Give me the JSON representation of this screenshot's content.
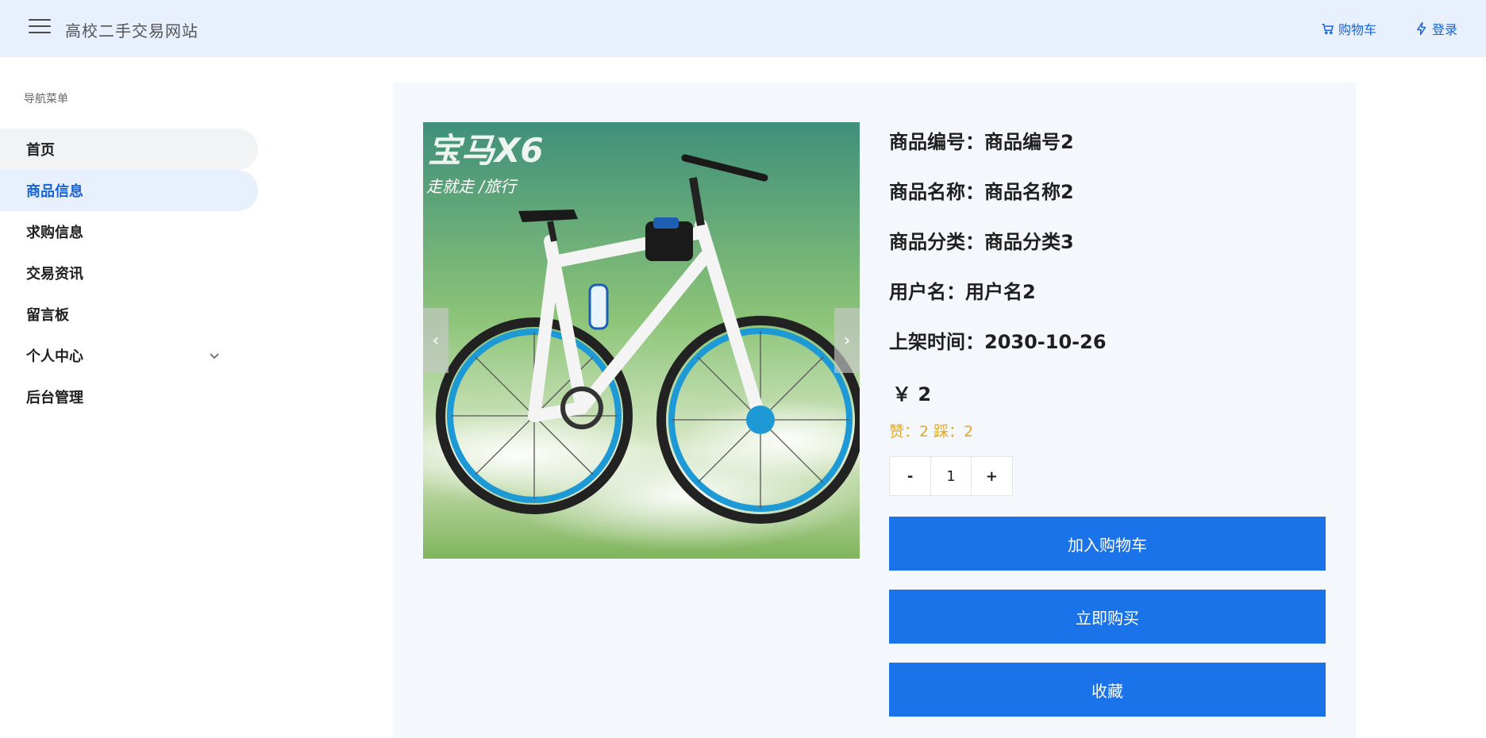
{
  "header": {
    "site_title": "高校二手交易网站",
    "cart_label": "购物车",
    "login_label": "登录"
  },
  "sidebar": {
    "caption": "导航菜单",
    "items": [
      {
        "label": "首页"
      },
      {
        "label": "商品信息"
      },
      {
        "label": "求购信息"
      },
      {
        "label": "交易资讯"
      },
      {
        "label": "留言板"
      },
      {
        "label": "个人中心"
      },
      {
        "label": "后台管理"
      }
    ]
  },
  "product": {
    "image_caption": {
      "brand": "宝马X6",
      "slogan": "走就走 /旅行"
    },
    "code_line": "商品编号：商品编号2",
    "name_line": "商品名称：商品名称2",
    "category_line": "商品分类：商品分类3",
    "user_line": "用户名：用户名2",
    "date_line": "上架时间：2030-10-26",
    "price": "￥ 2",
    "votes": "赞：2 踩：2",
    "quantity": "1",
    "minus": "-",
    "plus": "+"
  },
  "actions": {
    "add_cart": "加入购物车",
    "buy_now": "立即购买",
    "favorite": "收藏"
  },
  "colors": {
    "accent": "#1a73e8",
    "header_bg": "#e8f0fd",
    "vote_color": "#e5a823"
  }
}
